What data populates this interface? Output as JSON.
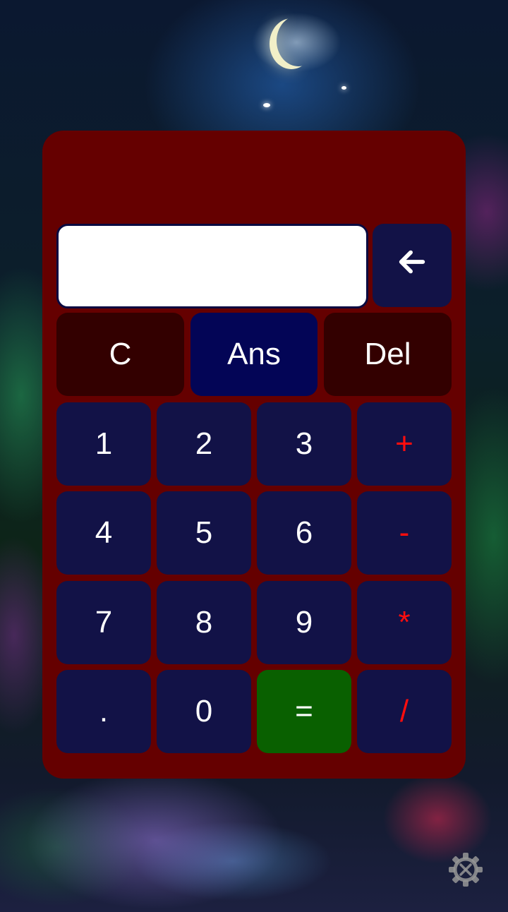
{
  "display": {
    "value": ""
  },
  "buttons": {
    "backspace_icon": "arrow-left-icon",
    "clear": "C",
    "ans": "Ans",
    "del": "Del",
    "one": "1",
    "two": "2",
    "three": "3",
    "plus": "+",
    "four": "4",
    "five": "5",
    "six": "6",
    "minus": "-",
    "seven": "7",
    "eight": "8",
    "nine": "9",
    "multiply": "*",
    "dot": ".",
    "zero": "0",
    "equals": "=",
    "divide": "/"
  },
  "settings_icon": "gear-icon",
  "colors": {
    "panel": "#650000",
    "key": "#121247",
    "key_dark": "#330000",
    "key_ans": "#030556",
    "key_equals": "#096000",
    "operator_text": "#ff0d0d"
  }
}
